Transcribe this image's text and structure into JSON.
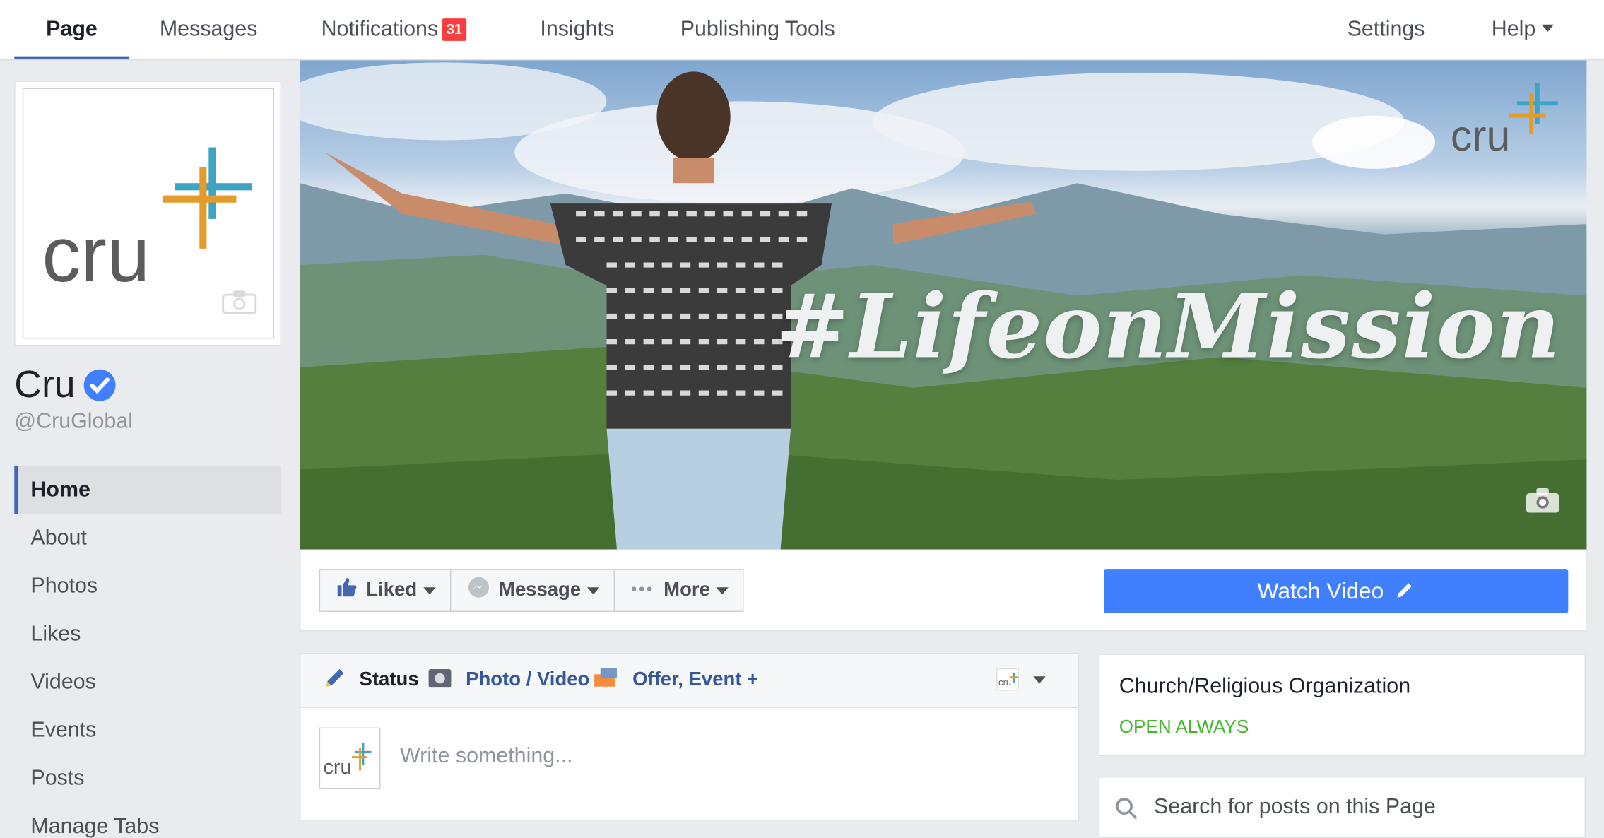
{
  "topnav": {
    "page": "Page",
    "messages": "Messages",
    "notifications": "Notifications",
    "notifications_count": "31",
    "insights": "Insights",
    "publishing_tools": "Publishing Tools",
    "settings": "Settings",
    "help": "Help"
  },
  "profile": {
    "logo_text": "cru",
    "name": "Cru",
    "handle": "@CruGlobal",
    "verified": true
  },
  "sidebar": {
    "items": [
      {
        "label": "Home",
        "active": true
      },
      {
        "label": "About"
      },
      {
        "label": "Photos"
      },
      {
        "label": "Likes"
      },
      {
        "label": "Videos"
      },
      {
        "label": "Events"
      },
      {
        "label": "Posts"
      },
      {
        "label": "Manage Tabs"
      }
    ]
  },
  "cover": {
    "headline": "#LifeonMission",
    "logo_text": "cru"
  },
  "actions": {
    "liked": "Liked",
    "message": "Message",
    "more": "More",
    "watch_video": "Watch Video"
  },
  "composer": {
    "tab_status": "Status",
    "tab_photo_video": "Photo / Video",
    "tab_offer_event": "Offer, Event +",
    "avatar_text": "cru",
    "placeholder": "Write something..."
  },
  "info": {
    "category": "Church/Religious Organization",
    "open_status": "OPEN ALWAYS"
  },
  "search": {
    "placeholder": "Search for posts on this Page"
  },
  "colors": {
    "accent": "#4267b2",
    "button_blue": "#4080ff",
    "badge_red": "#fa3e3e",
    "open_green": "#42b72a"
  }
}
